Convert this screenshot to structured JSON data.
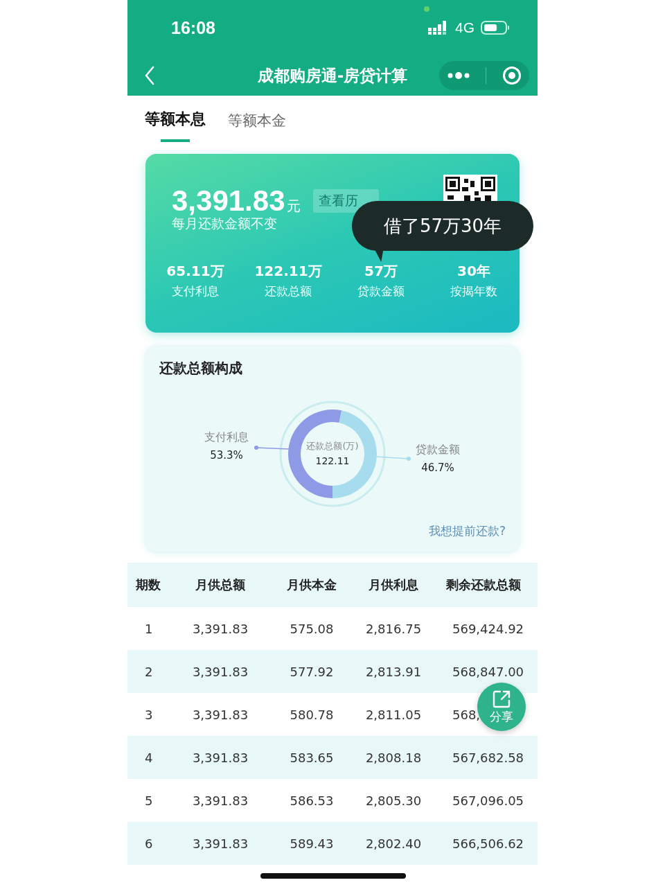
{
  "status_bar": {
    "time": "16:08",
    "network": "4G"
  },
  "nav": {
    "title": "成都购房通-房贷计算"
  },
  "tabs": [
    {
      "label": "等额本息",
      "selected": true
    },
    {
      "label": "等额本金",
      "selected": false
    }
  ],
  "summary": {
    "amount": "3,391.83",
    "unit": "元",
    "history_button": "查看历",
    "subtitle": "每月还款金额不变",
    "stats": [
      {
        "value": "65.11万",
        "label": "支付利息"
      },
      {
        "value": "122.11万",
        "label": "还款总额"
      },
      {
        "value": "57万",
        "label": "贷款金额"
      },
      {
        "value": "30年",
        "label": "按揭年数"
      }
    ]
  },
  "tooltip": {
    "text": "借了57万30年"
  },
  "composition": {
    "title": "还款总额构成",
    "center_label": "还款总额(万)",
    "center_value": "122.11",
    "chart_data": {
      "type": "donut",
      "categories": [
        "支付利息",
        "贷款金额"
      ],
      "series": [
        {
          "values": [
            53.3,
            46.7
          ]
        }
      ]
    },
    "slice_labels": [
      {
        "percent": "53.3%",
        "color": "#8e9ae6"
      },
      {
        "percent": "46.7%",
        "color": "#a7dcee"
      }
    ],
    "link": "我想提前还款?"
  },
  "table": {
    "columns": [
      "期数",
      "月供总额",
      "月供本金",
      "月供利息",
      "剩余还款总额"
    ],
    "rows": [
      [
        "1",
        "3,391.83",
        "575.08",
        "2,816.75",
        "569,424.92"
      ],
      [
        "2",
        "3,391.83",
        "577.92",
        "2,813.91",
        "568,847.00"
      ],
      [
        "3",
        "3,391.83",
        "580.78",
        "2,811.05",
        "568,"
      ],
      [
        "4",
        "3,391.83",
        "583.65",
        "2,808.18",
        "567,682.58"
      ],
      [
        "5",
        "3,391.83",
        "586.53",
        "2,805.30",
        "567,096.05"
      ],
      [
        "6",
        "3,391.83",
        "589.43",
        "2,802.40",
        "566,506.62"
      ]
    ]
  },
  "share_button": {
    "label": "分享"
  }
}
